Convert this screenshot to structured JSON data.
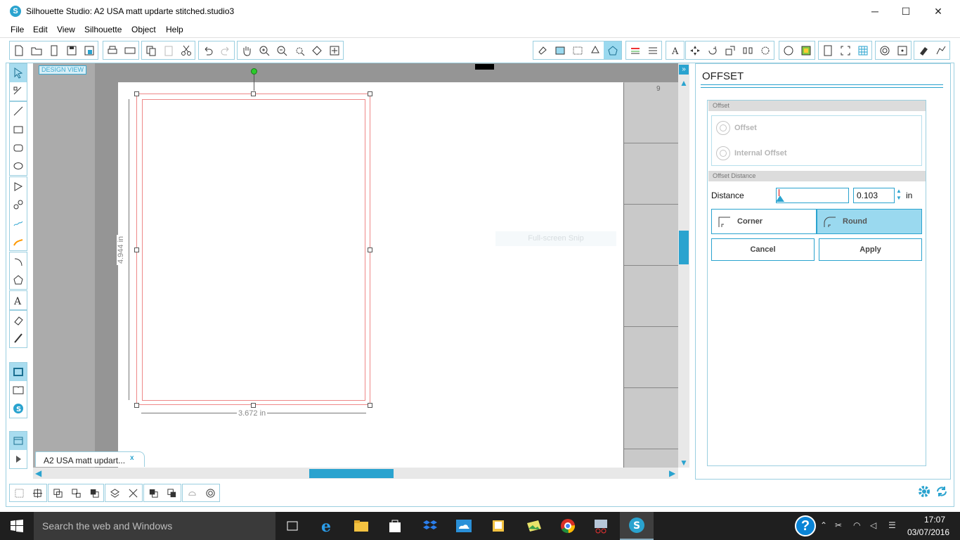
{
  "window": {
    "title": "Silhouette Studio: A2 USA matt updarte stitched.studio3",
    "minimize": "─",
    "maximize": "☐",
    "close": "✕"
  },
  "menu": [
    "File",
    "Edit",
    "View",
    "Silhouette",
    "Object",
    "Help"
  ],
  "canvas": {
    "design_view_label": "DESIGN VIEW",
    "grid_number": "9",
    "width_dimension": "3.672 in",
    "height_dimension": "4.944 in",
    "snip_overlay": "Full-screen Snip"
  },
  "document_tab": {
    "label": "A2 USA matt updart...",
    "close": "x"
  },
  "panel": {
    "title": "OFFSET",
    "offset_section": "Offset",
    "offset_option": "Offset",
    "internal_offset_option": "Internal Offset",
    "distance_section": "Offset Distance",
    "distance_label": "Distance",
    "distance_value": "0.103",
    "distance_unit": "in",
    "corner_label": "Corner",
    "round_label": "Round",
    "corner_style_selected": "Round",
    "cancel_label": "Cancel",
    "apply_label": "Apply"
  },
  "taskbar": {
    "search_placeholder": "Search the web and Windows",
    "time": "17:07",
    "date": "03/07/2016",
    "help": "?"
  },
  "colors": {
    "accent": "#2aa3cf",
    "accent_light": "#9ad9ef",
    "cut_line": "#e88888"
  }
}
